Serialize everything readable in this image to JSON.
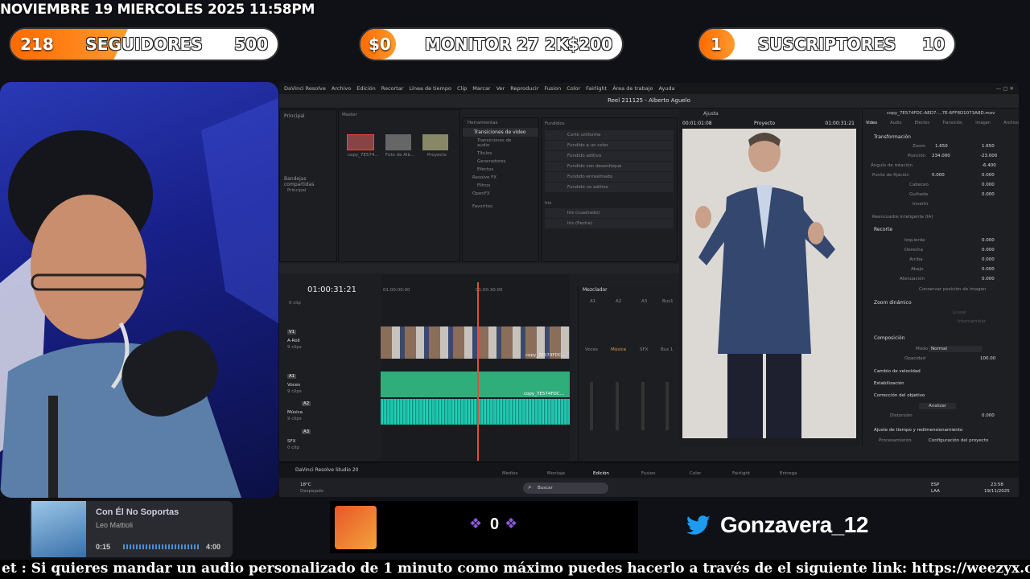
{
  "overlay": {
    "datetime": "NOVIEMBRE 19 MIERCOLES 2025 11:58PM",
    "goals": [
      {
        "value": "218",
        "label": "SEGUIDORES",
        "goal": "500",
        "progress": 0.436
      },
      {
        "value": "$0",
        "label": "MONITOR 27 2K",
        "goal": "$200",
        "progress": 0.0
      },
      {
        "value": "1",
        "label": "SUSCRIPTORES",
        "goal": "10",
        "progress": 0.1
      }
    ]
  },
  "resolve": {
    "menu": [
      "DaVinci Resolve",
      "Archivo",
      "Edición",
      "Recortar",
      "Línea de tiempo",
      "Clip",
      "Marcar",
      "Ver",
      "Reproducir",
      "Fusion",
      "Color",
      "Fairlight",
      "Área de trabajo",
      "Ayuda"
    ],
    "project_title": "Reel 211125 - Alberto Aguelo",
    "media_pool": {
      "principal": "Principal",
      "master": "Master",
      "clips": [
        "copy_7E574...",
        "Foto de Alb...",
        "Proyecto"
      ],
      "shared_bins": "Bandejas compartidas",
      "shared_principal": "Principal"
    },
    "effects": {
      "header": "Herramientas",
      "items": [
        "Transiciones de video",
        "Transiciones de audio",
        "Títulos",
        "Generadores",
        "Efectos",
        "Resolve FX",
        "Filtros",
        "OpenFX",
        "Favoritos"
      ],
      "fundidos_title": "Fundidos",
      "fundidos": [
        "Corte uniforme",
        "Fundido a un color",
        "Fundido aditivo",
        "Fundido con desenfoque",
        "Fundido enrasimado",
        "Fundido no aditivo"
      ],
      "iris_title": "Iris",
      "iris": [
        "Iris (cuadrado)",
        "Iris (flecha)"
      ]
    },
    "viewer": {
      "zoom": "Ajusta",
      "source_tc": "00:01:01:08",
      "label": "Proyecto",
      "record_tc": "01:00:31:21"
    },
    "inspector": {
      "file": "copy_7E574FDC-AED7-...7E-6FF8D1073A8D.mov",
      "tabs": [
        "Video",
        "Audio",
        "Efectos",
        "Transición",
        "Imagen",
        "Archivo"
      ],
      "transform_title": "Transformación",
      "zoom_label": "Zoom",
      "zoom_x": "1.650",
      "zoom_y": "1.650",
      "pos_label": "Posición",
      "pos_x": "234.000",
      "pos_y": "-23.000",
      "rot_label": "Ángulo de rotación",
      "rot": "-6.400",
      "anchor_label": "Punto de fijación",
      "anchor_x": "0.000",
      "anchor_y": "0.000",
      "pitch_label": "Cabeceo",
      "pitch": "0.000",
      "yaw_label": "Guiñada",
      "yaw": "0.000",
      "invert_label": "Invertir",
      "smart_reframe": "Reencuadre inteligente (IA)",
      "crop_title": "Recorte",
      "crop_rows": [
        [
          "Izquierda",
          "0.000"
        ],
        [
          "Derecha",
          "0.000"
        ],
        [
          "Arriba",
          "0.000"
        ],
        [
          "Abajo",
          "0.000"
        ],
        [
          "Atenuación",
          "0.000"
        ]
      ],
      "keep_image": "Conservar posición de imagen",
      "dynamic_zoom": "Zoom dinámico",
      "dz_mode": "Lineal",
      "dz_swap": "Intercambiar",
      "composite_title": "Composición",
      "mode_label": "Modo",
      "mode_value": "Normal",
      "opacity_label": "Opacidad",
      "opacity_value": "100.00",
      "speed_change": "Cambio de velocidad",
      "stabilization": "Estabilización",
      "lens_correction": "Corrección del objetivo",
      "analyze": "Analizar",
      "distortion_label": "Distorsión",
      "distortion_value": "0.000",
      "retime": "Ajuste de tiempo y redimensionamiento",
      "process_label": "Procesamiento",
      "process_value": "Configuración del proyecto",
      "motion_label": "Modo",
      "motion_value": "Configuración del proyecto"
    },
    "timeline": {
      "timecode": "01:00:31:21",
      "ruler": [
        "01:00:00:00",
        "01:00:30:00"
      ],
      "tracks": [
        {
          "id": "V1",
          "name": "A-Roll",
          "clips": "9 clips"
        },
        {
          "id": "A1",
          "name": "Voces",
          "clips": "9 clips"
        },
        {
          "id": "A2",
          "name": "Música",
          "clips": "9 clips"
        },
        {
          "id": "A3",
          "name": "SFX",
          "clips": "0 clip"
        }
      ],
      "top_clip_note": "0 clip",
      "clip_label": "copy_7E574FDC..."
    },
    "mixer": {
      "title": "Mezclador",
      "channels": [
        "A1",
        "A2",
        "A3",
        "Bus1"
      ],
      "strips": [
        "Voces",
        "Música",
        "SFX",
        "Bus 1"
      ]
    },
    "pages": [
      "Medios",
      "Montaje",
      "Edición",
      "Fusion",
      "Color",
      "Fairlight",
      "Entrega"
    ],
    "active_page": "Edición",
    "app_name": "DaVinci Resolve Studio 20"
  },
  "taskbar": {
    "weather_temp": "18°C",
    "weather_desc": "Despejado",
    "search": "Buscar",
    "lang": "ESP",
    "lang2": "LAA",
    "time": "23:58",
    "date": "19/11/2025"
  },
  "music": {
    "title": "Con Él No Soportas",
    "artist": "Leo Mattioli",
    "elapsed": "0:15",
    "total": "4:00",
    "progress": 0.0625
  },
  "center": {
    "count": "0"
  },
  "twitter": {
    "handle": "Gonzavera_12"
  },
  "ticker": {
    "text": "et :  Si quieres mandar un audio personalizado de 1 minuto como máximo puedes hacerlo a través de el siguiente link: https://weezyx.com/t/gonzavera_"
  },
  "colors": {
    "accent": "#ff7a00",
    "resolve_red": "#e64b3c",
    "audio": "#1fbfa8",
    "twitter": "#1d9bf0"
  }
}
